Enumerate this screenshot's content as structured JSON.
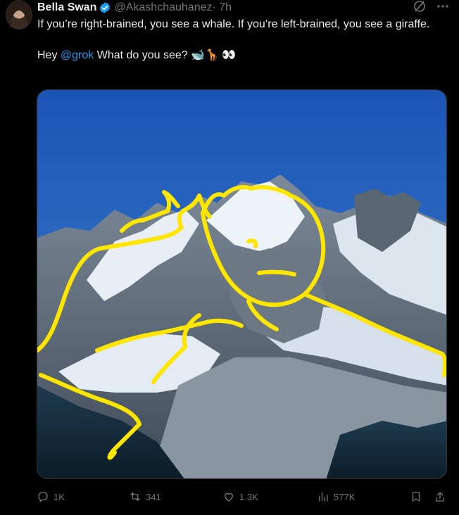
{
  "author": {
    "name": "Bella Swan",
    "handle": "@Akashchauhanez",
    "time": "· 7h"
  },
  "tweet": {
    "line1": "If you’re right-brained, you see a whale. If you’re left-brained, you see a giraffe.",
    "line2_prefix": "Hey ",
    "mention": "@grok",
    "line2_suffix": " What do you see? 🐋🦒 👀"
  },
  "stats": {
    "replies": "1K",
    "reposts": "341",
    "likes": "1.3K",
    "views": "577K"
  },
  "colors": {
    "accent": "#1d9bf0",
    "muted": "#71767b",
    "doodle": "#ffe600"
  },
  "icons": [
    "verified-icon",
    "grok-icon",
    "more-icon",
    "reply-icon",
    "repost-icon",
    "like-icon",
    "views-icon",
    "bookmark-icon",
    "share-icon"
  ]
}
